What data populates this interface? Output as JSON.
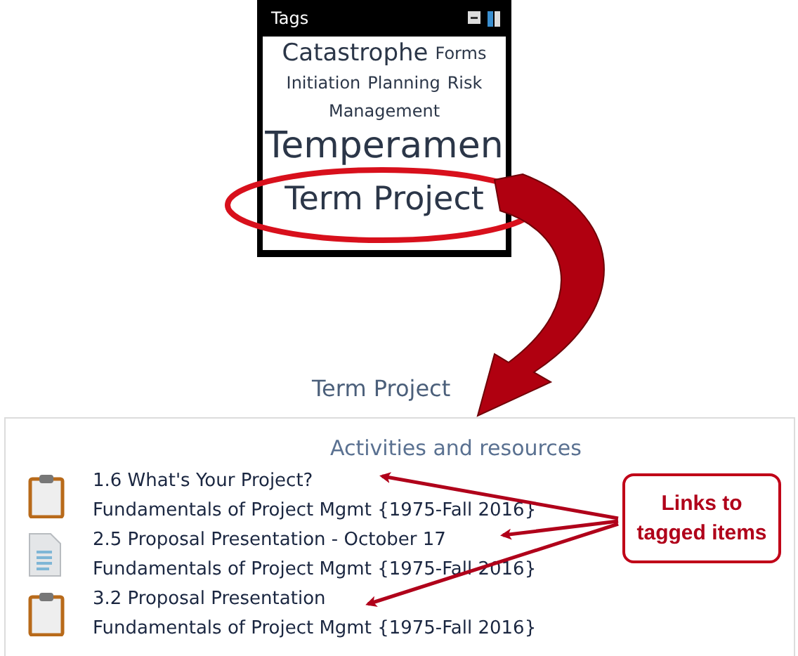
{
  "tags_block": {
    "title": "Tags",
    "tags": [
      {
        "label": "Catastrophe",
        "kind": "large"
      },
      {
        "label": "Forms",
        "kind": "small"
      },
      {
        "label": "Initiation",
        "kind": "small"
      },
      {
        "label": "Planning",
        "kind": "small"
      },
      {
        "label": "Risk",
        "kind": "small"
      },
      {
        "label": "Management",
        "kind": "small"
      },
      {
        "label": "Temperamen",
        "kind": "huge"
      },
      {
        "label": "Term Project",
        "kind": "xlarge"
      }
    ]
  },
  "tag_heading": "Term Project",
  "section": {
    "title": "Activities and resources",
    "items": [
      {
        "kind": "assignment",
        "title": "1.6 What's Your Project?",
        "course": "Fundamentals of Project Mgmt {1975-Fall 2016}"
      },
      {
        "kind": "file",
        "title": "2.5 Proposal Presentation - October 17",
        "course": "Fundamentals of Project Mgmt {1975-Fall 2016}"
      },
      {
        "kind": "assignment",
        "title": "3.2 Proposal Presentation",
        "course": "Fundamentals of Project Mgmt {1975-Fall 2016}"
      }
    ]
  },
  "callout": "Links to tagged items"
}
